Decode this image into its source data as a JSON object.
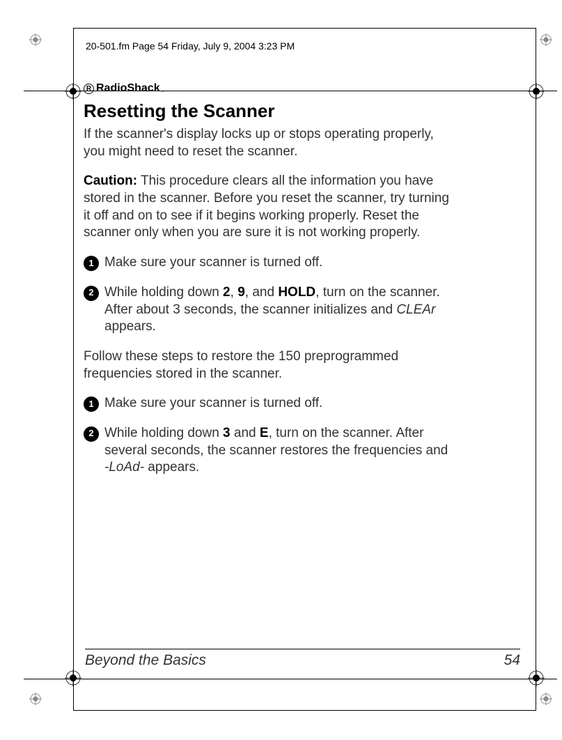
{
  "header": {
    "text": "20-501.fm  Page 54  Friday, July 9, 2004  3:23 PM"
  },
  "brand": {
    "symbol": "R",
    "name": "RadioShack",
    "suffix": "."
  },
  "section": {
    "title": "Resetting the Scanner",
    "intro": "If the scanner's display locks up or stops operating properly, you might need to reset the scanner.",
    "caution_label": "Caution:",
    "caution_text": " This procedure clears all the information you have stored in the scanner. Before you reset the scanner, try turning it off and on to see if it begins working properly. Reset the scanner only when you are sure it is not working properly.",
    "steps_a": [
      {
        "num": "1",
        "text": "Make sure your scanner is turned off."
      },
      {
        "num": "2",
        "pre": "While holding down ",
        "k1": "2",
        "c1": ", ",
        "k2": "9",
        "c2": ", and ",
        "k3": "HOLD",
        "post": ", turn on the scanner. After about 3 seconds, the scanner initializes and ",
        "italic": "CLEAr",
        "end": " appears."
      }
    ],
    "mid_text": "Follow these steps to restore the 150 preprogrammed frequencies stored in the scanner.",
    "steps_b": [
      {
        "num": "1",
        "text": "Make sure your scanner is turned off."
      },
      {
        "num": "2",
        "pre": "While holding down ",
        "k1": "3",
        "c1": " and ",
        "k2": "E",
        "post": ", turn on the scanner. After several seconds, the scanner restores the frequencies and ",
        "italic": "-LoAd-",
        "end": " appears."
      }
    ]
  },
  "footer": {
    "title": "Beyond the Basics",
    "page": "54"
  }
}
